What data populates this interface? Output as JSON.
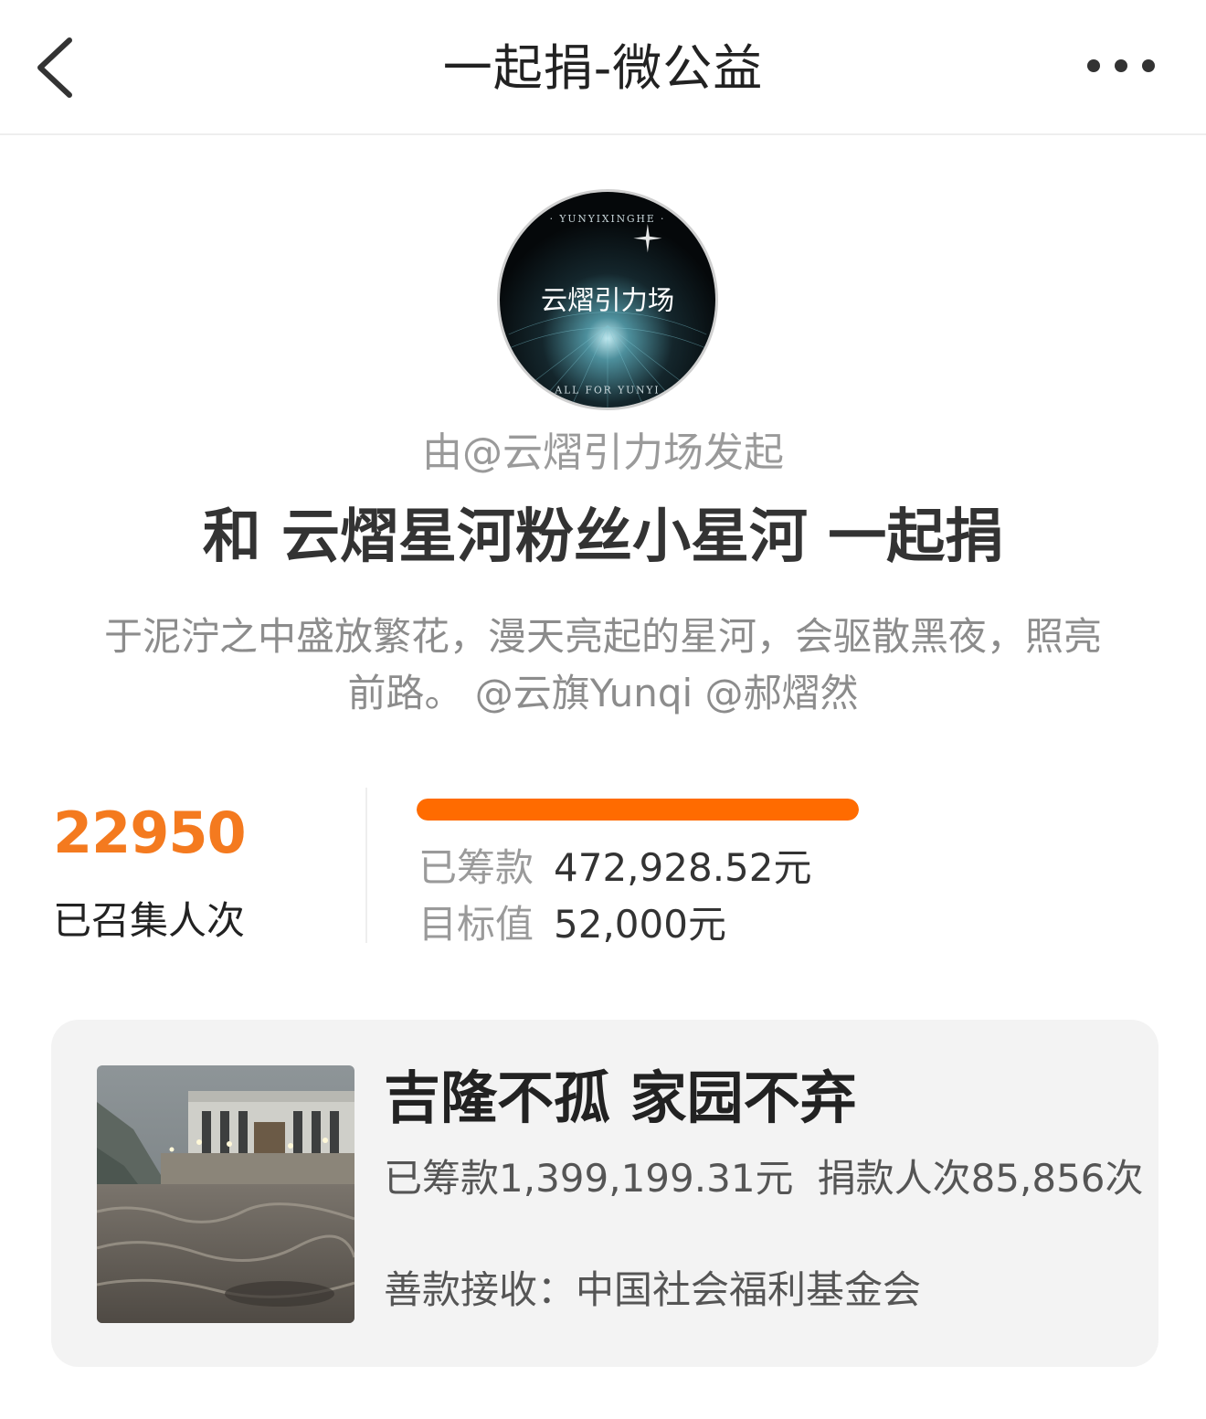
{
  "nav": {
    "title": "一起捐-微公益",
    "back_icon": "back-chevron-icon",
    "more_icon": "more-dots-icon"
  },
  "profile": {
    "avatar_ring_top": "· YUNYIXINGHE ·",
    "avatar_logo_text": "云熠引力场",
    "avatar_ring_bottom": "ALL FOR YUNYI",
    "initiator": "由@云熠引力场发起",
    "title": "和 云熠星河粉丝小星河 一起捐",
    "description": "于泥泞之中盛放繁花，漫天亮起的星河，会驱散黑夜，照亮前路。 @云旗Yunqi @郝熠然"
  },
  "stats": {
    "count": "22950",
    "count_label": "已召集人次",
    "progress_fraction": 1.0,
    "raised_label": "已筹款",
    "raised_value": "472,928.52元",
    "target_label": "目标值",
    "target_value": "52,000元"
  },
  "project": {
    "title": "吉隆不孤 家园不弃",
    "raised": "已筹款1,399,199.31元",
    "donors": "捐款人次85,856次",
    "recipient": "善款接收：中国社会福利基金会"
  },
  "colors": {
    "accent": "#f47a1f",
    "progress": "#ff6b00",
    "card_bg": "#f3f3f3"
  }
}
